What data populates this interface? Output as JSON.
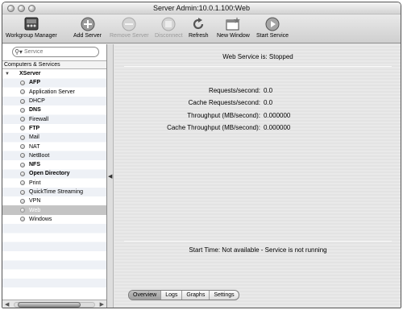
{
  "window": {
    "title": "Server Admin:10.0.1.100:Web"
  },
  "toolbar": {
    "workgroup_manager": "Workgroup Manager",
    "add_server": "Add Server",
    "remove_server": "Remove Server",
    "disconnect": "Disconnect",
    "refresh": "Refresh",
    "new_window": "New Window",
    "start_service": "Start Service"
  },
  "sidebar": {
    "search_placeholder": "Service",
    "section_header": "Computers & Services",
    "server": "XServer",
    "services": [
      {
        "label": "AFP",
        "bold": true
      },
      {
        "label": "Application Server",
        "bold": false
      },
      {
        "label": "DHCP",
        "bold": false
      },
      {
        "label": "DNS",
        "bold": true
      },
      {
        "label": "Firewall",
        "bold": false
      },
      {
        "label": "FTP",
        "bold": true
      },
      {
        "label": "Mail",
        "bold": false
      },
      {
        "label": "NAT",
        "bold": false
      },
      {
        "label": "NetBoot",
        "bold": false
      },
      {
        "label": "NFS",
        "bold": true
      },
      {
        "label": "Open Directory",
        "bold": true
      },
      {
        "label": "Print",
        "bold": false
      },
      {
        "label": "QuickTime Streaming",
        "bold": false
      },
      {
        "label": "VPN",
        "bold": false
      },
      {
        "label": "Web",
        "bold": false,
        "selected": true
      },
      {
        "label": "Windows",
        "bold": false
      }
    ]
  },
  "main": {
    "status": "Web Service is:  Stopped",
    "stats": [
      {
        "label": "Requests/second:",
        "value": "0.0"
      },
      {
        "label": "Cache Requests/second:",
        "value": "0.0"
      },
      {
        "label": "Throughput (MB/second):",
        "value": "0.000000"
      },
      {
        "label": "Cache Throughput (MB/second):",
        "value": "0.000000"
      }
    ],
    "start_time": "Start Time: Not available - Service is not running",
    "tabs": [
      "Overview",
      "Logs",
      "Graphs",
      "Settings"
    ]
  }
}
